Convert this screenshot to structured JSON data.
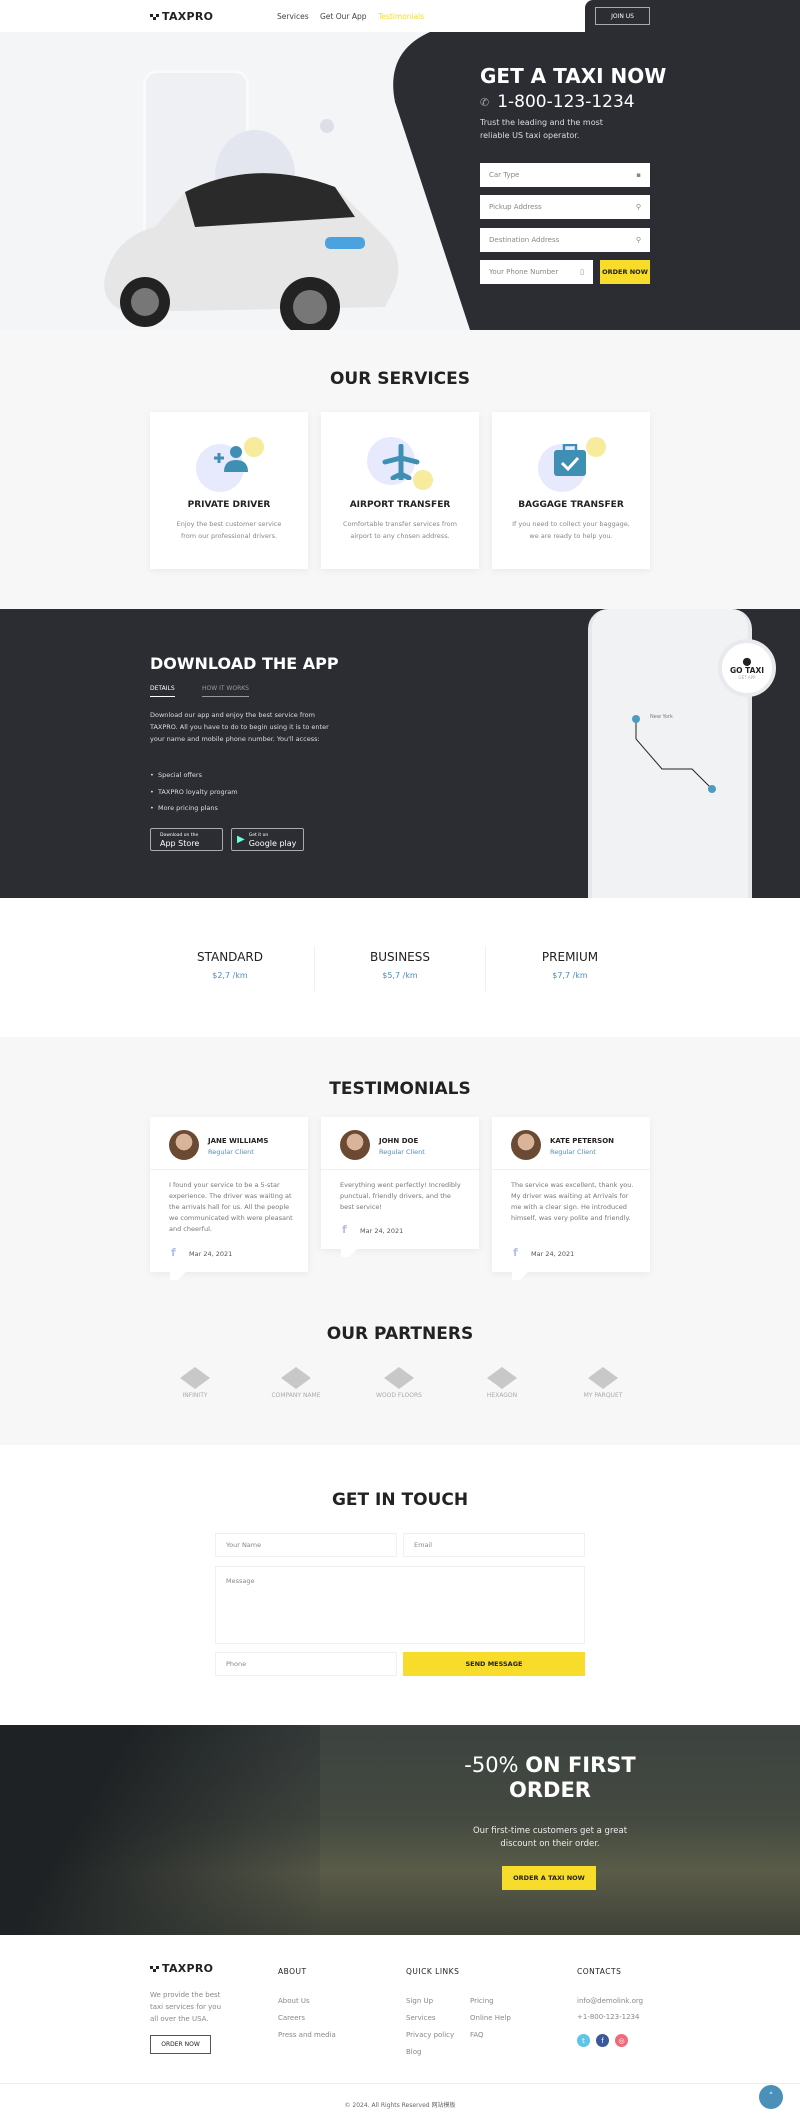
{
  "nav": {
    "logo": "TAXPRO",
    "links": [
      "Services",
      "Get Our App",
      "Testimonials"
    ],
    "join": "JOIN US"
  },
  "hero": {
    "title": "GET A TAXI NOW",
    "phone": "1-800-123-1234",
    "subtitle_1": "Trust the leading and the most",
    "subtitle_2": "reliable US taxi operator.",
    "fields": [
      "Car Type",
      "Pickup Address",
      "Destination Address",
      "Your Phone Number"
    ],
    "order": "ORDER NOW"
  },
  "services": {
    "title": "OUR SERVICES",
    "items": [
      {
        "title": "PRIVATE DRIVER",
        "d1": "Enjoy the best customer service",
        "d2": "from our professional drivers.",
        "icon": "user-plus-icon"
      },
      {
        "title": "AIRPORT TRANSFER",
        "d1": "Comfortable transfer services from",
        "d2": "airport to any chosen address.",
        "icon": "airplane-icon"
      },
      {
        "title": "BAGGAGE TRANSFER",
        "d1": "If you need to collect your baggage,",
        "d2": "we are ready to help you.",
        "icon": "briefcase-check-icon"
      }
    ]
  },
  "app": {
    "title": "DOWNLOAD THE APP",
    "tabs": [
      "DETAILS",
      "HOW IT WORKS"
    ],
    "text": "Download our app and enjoy the best service from TAXPRO. All you have to do to begin using it is to enter your name and mobile phone number. You'll access:",
    "bullets": [
      "Special offers",
      "TAXPRO loyalty program",
      "More pricing plans"
    ],
    "appstore_small": "Download on the",
    "appstore": "App Store",
    "google_small": "Get it on",
    "google": "Google play",
    "badge": "GO TAXI",
    "badge_sub": "GET APP",
    "map_label": "New York"
  },
  "pricing": [
    {
      "name": "STANDARD",
      "price": "$2,7 /km"
    },
    {
      "name": "BUSINESS",
      "price": "$5,7 /km"
    },
    {
      "name": "PREMIUM",
      "price": "$7,7 /km"
    }
  ],
  "testimonials": {
    "title": "TESTIMONIALS",
    "items": [
      {
        "name": "JANE WILLIAMS",
        "role": "Regular Client",
        "text": "I found your service to be a 5-star experience. The driver was waiting at the arrivals hall for us. All the people we communicated with were pleasant and cheerful.",
        "date": "Mar 24, 2021"
      },
      {
        "name": "JOHN DOE",
        "role": "Regular Client",
        "text": "Everything went perfectly! Incredibly punctual, friendly drivers, and the best service!",
        "date": "Mar 24, 2021"
      },
      {
        "name": "KATE PETERSON",
        "role": "Regular Client",
        "text": "The service was excellent, thank you. My driver was waiting at Arrivals for me with a clear sign. He introduced himself, was very polite and friendly.",
        "date": "Mar 24, 2021"
      }
    ]
  },
  "partners": {
    "title": "OUR PARTNERS",
    "items": [
      "INFINITY",
      "COMPANY NAME",
      "WOOD FLOORS",
      "HEXAGON",
      "MY PARQUET"
    ]
  },
  "contact": {
    "title": "GET IN TOUCH",
    "name": "Your Name",
    "email": "Email",
    "message": "Message",
    "phone": "Phone",
    "send": "SEND MESSAGE"
  },
  "promo": {
    "pct": "-50%",
    "title_a": "ON FIRST",
    "title_b": "ORDER",
    "text_1": "Our first-time customers get a great",
    "text_2": "discount on their order.",
    "button": "ORDER A TAXI NOW"
  },
  "footer": {
    "logo": "TAXPRO",
    "about_text": [
      "We provide the best",
      "taxi services for you",
      "all over the USA."
    ],
    "order": "ORDER NOW",
    "about_title": "ABOUT",
    "about_links": [
      "About Us",
      "Careers",
      "Press and media"
    ],
    "quick_title": "QUICK LINKS",
    "quick_a": [
      "Sign Up",
      "Services",
      "Privacy policy",
      "Blog"
    ],
    "quick_b": [
      "Pricing",
      "Online Help",
      "FAQ"
    ],
    "contacts_title": "CONTACTS",
    "email": "info@demolink.org",
    "phone": "+1-800-123-1234",
    "copyright": "© 2024. All Rights Reserved 网站模板"
  },
  "colors": {
    "accent": "#f7dc2b",
    "dark": "#2b2d33",
    "blue": "#4a90b8"
  }
}
